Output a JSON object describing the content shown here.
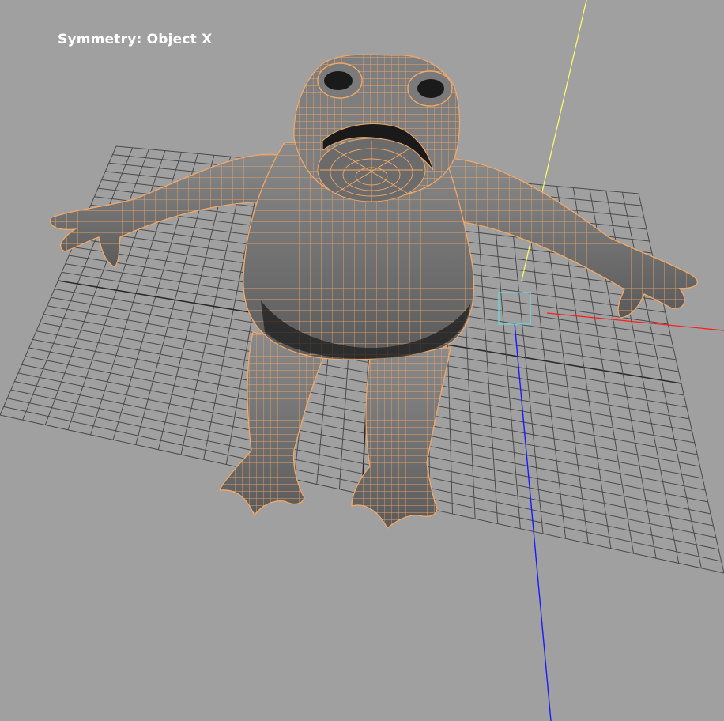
{
  "viewport": {
    "background_color": "#a0a0a0",
    "hud": {
      "symmetry_label": "Symmetry: Object X"
    },
    "grid": {
      "visible": true,
      "line_color": "#4a4a4a",
      "axis_line_color": "#2a2a2a"
    },
    "axes": {
      "x_color": "#ff1a1a",
      "y_color": "#ffff66",
      "z_color": "#1a1aff"
    },
    "mesh": {
      "name_icon": "frog-mesh",
      "shade_color": "#7a7a7a",
      "wireframe_color": "#f0a868",
      "selected": true
    },
    "manipulator": {
      "icon": "move-manipulator-square",
      "color": "#6fd3e0"
    }
  }
}
